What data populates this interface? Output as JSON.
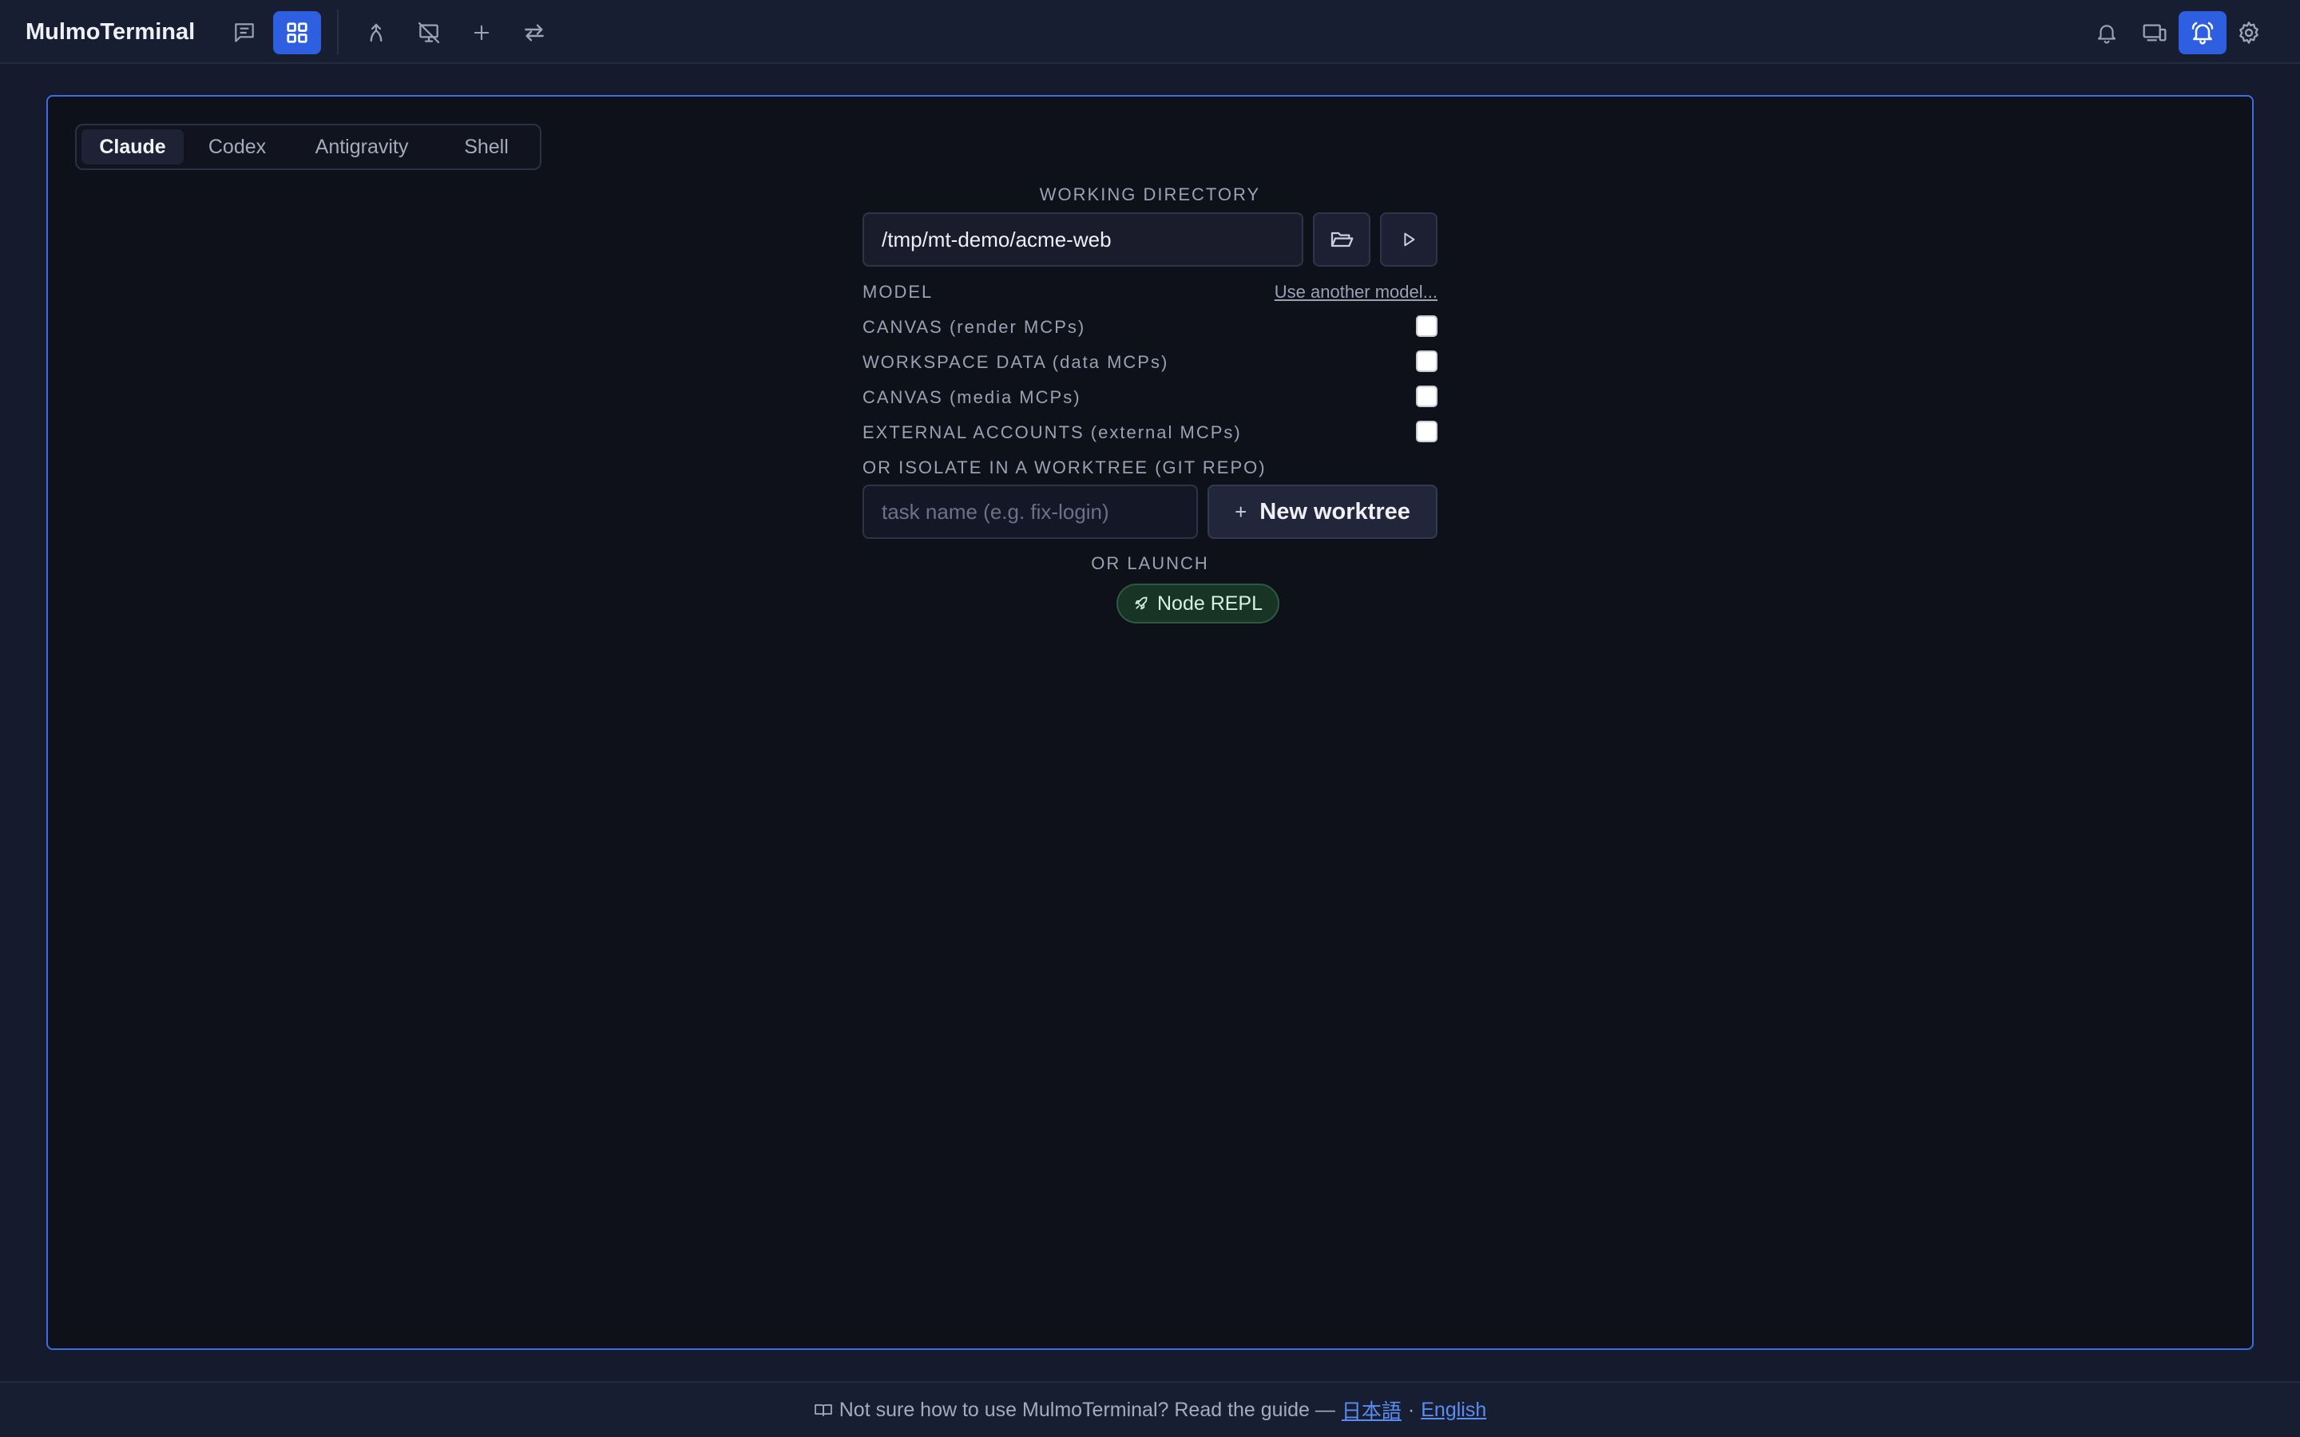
{
  "app": {
    "title": "MulmoTerminal"
  },
  "toolbar": {
    "left_icons": [
      "chat-icon",
      "grid-icon",
      "merge-icon",
      "no-screen-icon",
      "plus-icon",
      "swap-icon"
    ],
    "right_icons": [
      "bell-icon",
      "devices-icon",
      "bell-ring-icon",
      "gear-icon"
    ],
    "active_left": "grid-icon",
    "active_right": "bell-ring-icon"
  },
  "tabs": [
    {
      "label": "Claude",
      "active": true
    },
    {
      "label": "Codex",
      "active": false
    },
    {
      "label": "Antigravity",
      "active": false
    },
    {
      "label": "Shell",
      "active": false
    }
  ],
  "form": {
    "working_directory_label": "WORKING DIRECTORY",
    "working_directory_value": "/tmp/mt-demo/acme-web",
    "model_label": "MODEL",
    "model_link": "Use another model...",
    "options": [
      {
        "label": "CANVAS (render MCPs)",
        "checked": false
      },
      {
        "label": "WORKSPACE DATA (data MCPs)",
        "checked": false
      },
      {
        "label": "CANVAS (media MCPs)",
        "checked": false
      },
      {
        "label": "EXTERNAL ACCOUNTS (external MCPs)",
        "checked": false
      }
    ],
    "worktree_label": "OR ISOLATE IN A WORKTREE (GIT REPO)",
    "task_placeholder": "task name (e.g. fix-login)",
    "new_worktree_label": "New worktree",
    "launch_label": "OR LAUNCH",
    "node_repl_label": "Node REPL"
  },
  "footer": {
    "text": "Not sure how to use MulmoTerminal? Read the guide —",
    "link_ja": "日本語",
    "separator": "·",
    "link_en": "English"
  },
  "colors": {
    "accent": "#2d5fe0",
    "panel_border": "#3b6fe0",
    "background": "#151b2c",
    "panel_bg": "#0e111a",
    "repl_green": "#173424"
  }
}
